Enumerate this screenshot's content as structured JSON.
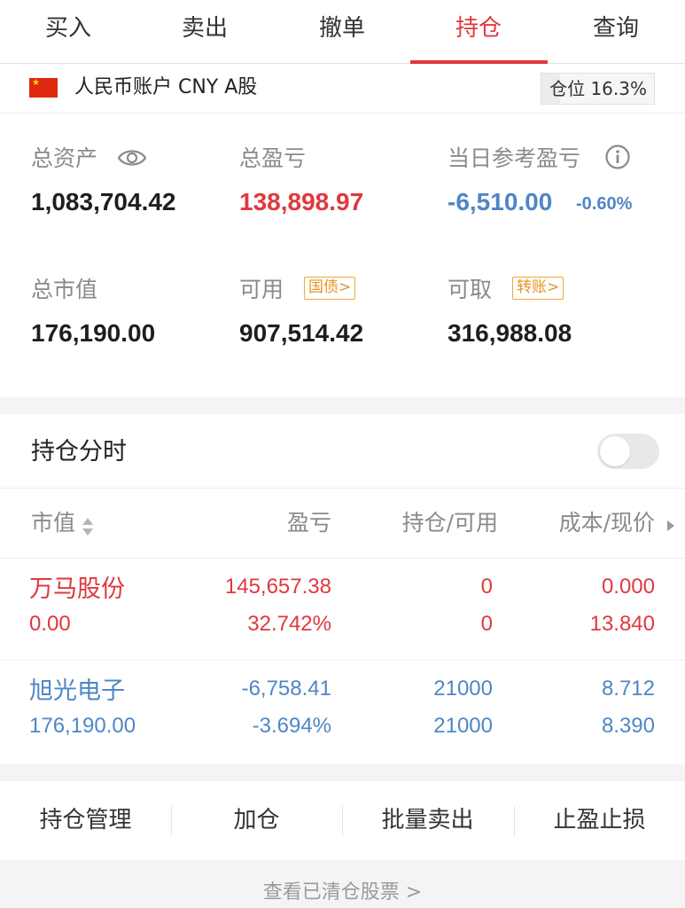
{
  "tabs": [
    "买入",
    "卖出",
    "撤单",
    "持仓",
    "查询"
  ],
  "account": {
    "flag_icon": "china-flag-icon",
    "label": "人民币账户 CNY A股",
    "position_badge": "仓位 16.3%",
    "position_ratio": 0.163,
    "stats": {
      "total_assets_label": "总资产",
      "total_assets": "1,083,704.42",
      "total_pnl_label": "总盈亏",
      "total_pnl": "138,898.97",
      "daily_pnl_label": "当日参考盈亏",
      "daily_pnl": "-6,510.00",
      "daily_pnl_pct": "-0.60%",
      "market_value_label": "总市值",
      "market_value": "176,190.00",
      "available_label": "可用",
      "available": "907,514.42",
      "available_tag": "国债>",
      "withdrawable_label": "可取",
      "withdrawable": "316,988.08",
      "withdrawable_tag": "转账>"
    }
  },
  "holdings": {
    "title": "持仓分时",
    "toggle_on": false,
    "columns": [
      "市值",
      "盈亏",
      "持仓/可用",
      "成本/现价"
    ],
    "rows": [
      {
        "name": "万马股份",
        "market_value": "0.00",
        "pnl": "145,657.38",
        "pnl_pct": "32.742%",
        "holding": "0",
        "available": "0",
        "cost": "0.000",
        "price": "13.840",
        "color": "#e0383e"
      },
      {
        "name": "旭光电子",
        "market_value": "176,190.00",
        "pnl": "-6,758.41",
        "pnl_pct": "-3.694%",
        "holding": "21000",
        "available": "21000",
        "cost": "8.712",
        "price": "8.390",
        "color": "#4f86c6"
      }
    ]
  },
  "actions": [
    "持仓管理",
    "加仓",
    "批量卖出",
    "止盈止损"
  ],
  "cleared_link": "查看已清仓股票 >",
  "colors": {
    "accent_red": "#e0383e",
    "loss_blue": "#4f86c6",
    "tag_orange": "#e8951f"
  }
}
